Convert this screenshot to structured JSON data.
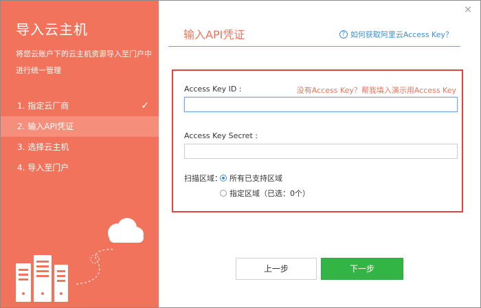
{
  "sidebar": {
    "title": "导入云主机",
    "description": "将您云账户下的云主机资源导入至门户中进行统一管理",
    "steps": [
      {
        "label": "1. 指定云厂商",
        "completed": true
      },
      {
        "label": "2. 输入API凭证",
        "active": true
      },
      {
        "label": "3. 选择云主机"
      },
      {
        "label": "4. 导入至门户"
      }
    ],
    "check_icon": "✓",
    "accent": "#f2735b"
  },
  "main": {
    "close_icon": "×",
    "title": "输入API凭证",
    "help_link": "如何获取阿里云Access Key？",
    "help_icon": "?",
    "form": {
      "access_key_id_label": "Access Key ID :",
      "access_key_id_value": "",
      "demo_link": "没有Access Key？帮我填入演示用Access Key",
      "access_key_secret_label": "Access Key Secret :",
      "access_key_secret_value": "",
      "region_label": "扫描区域：",
      "region_options": [
        {
          "label": "所有已支持区域",
          "selected": true
        },
        {
          "label": "指定区域（已选：0个）",
          "selected": false
        }
      ]
    },
    "buttons": {
      "prev": "上一步",
      "next": "下一步"
    }
  }
}
